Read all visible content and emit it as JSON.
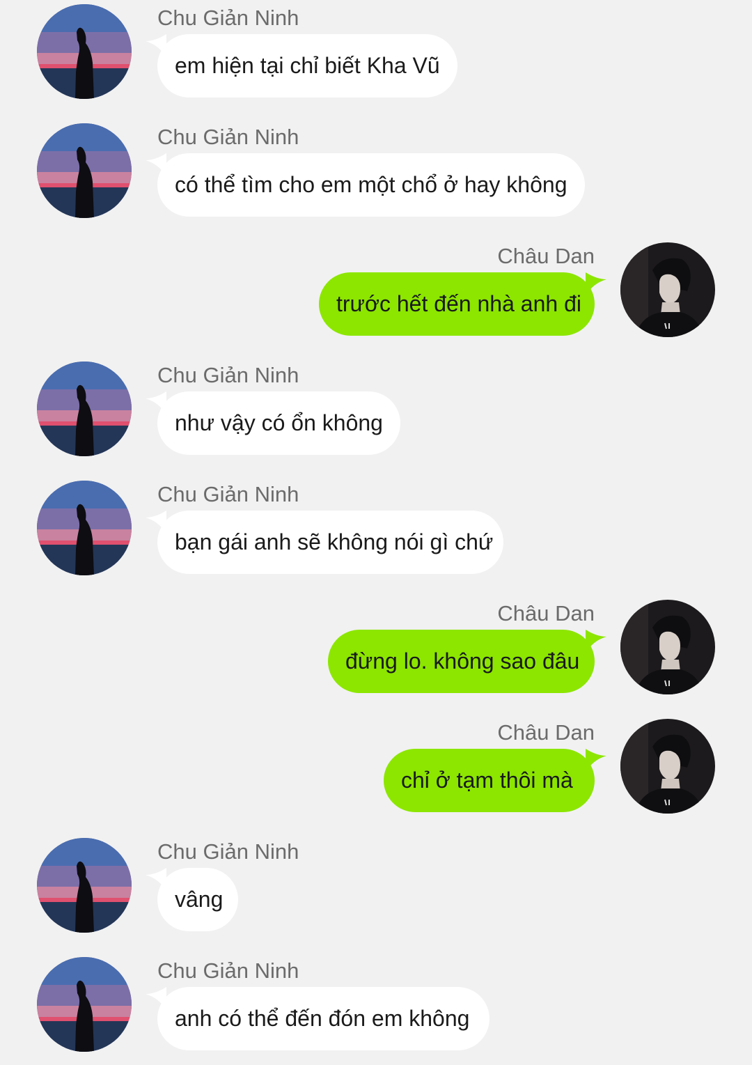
{
  "colors": {
    "background": "#f1f1f1",
    "incoming_bubble": "#ffffff",
    "outgoing_bubble": "#8ce600",
    "sender_name": "#6b6b6b",
    "message_text": "#1a1a1a"
  },
  "contacts": {
    "left": {
      "name": "Chu Giản Ninh",
      "avatar_icon": "silhouette-sunset-avatar"
    },
    "right": {
      "name": "Châu Dan",
      "avatar_icon": "dark-portrait-avatar"
    }
  },
  "messages": [
    {
      "side": "left",
      "sender": "Chu Giản Ninh",
      "text": "em hiện tại chỉ biết Kha Vũ"
    },
    {
      "side": "left",
      "sender": "Chu Giản Ninh",
      "text": "có thể tìm cho em một chổ ở hay không"
    },
    {
      "side": "right",
      "sender": "Châu Dan",
      "text": "trước hết đến nhà anh đi"
    },
    {
      "side": "left",
      "sender": "Chu Giản Ninh",
      "text": "như vậy có ổn không"
    },
    {
      "side": "left",
      "sender": "Chu Giản Ninh",
      "text": "bạn gái anh sẽ không nói gì chứ"
    },
    {
      "side": "right",
      "sender": "Châu Dan",
      "text": "đừng lo. không sao đâu"
    },
    {
      "side": "right",
      "sender": "Châu Dan",
      "text": "chỉ ở tạm thôi mà"
    },
    {
      "side": "left",
      "sender": "Chu Giản Ninh",
      "text": "vâng"
    },
    {
      "side": "left",
      "sender": "Chu Giản Ninh",
      "text": "anh có thể đến đón em không"
    }
  ]
}
